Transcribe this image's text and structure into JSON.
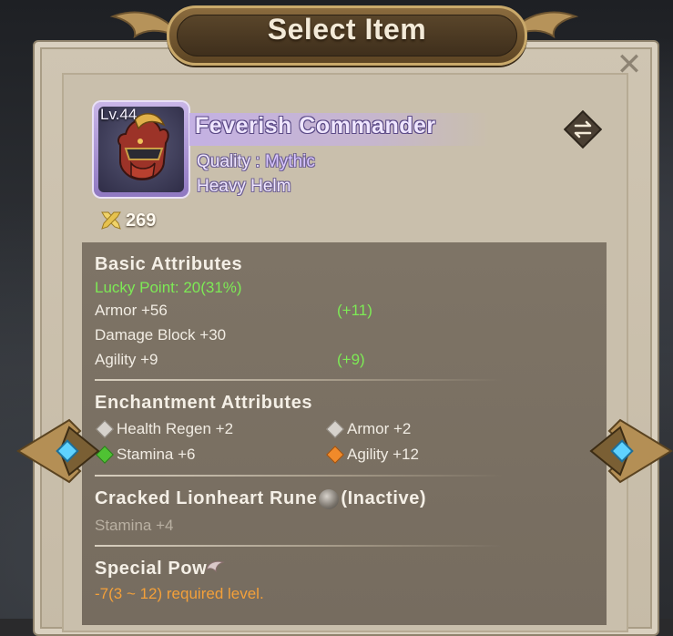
{
  "dialog": {
    "title": "Select Item",
    "close_icon": "close-icon"
  },
  "item": {
    "level": "Lv.44",
    "name": "Feverish Commander",
    "quality_label": "Quality : ",
    "quality_value": "Mythic",
    "type": "Heavy Helm",
    "power": "269",
    "icon": "helmet-icon",
    "swap_icon": "swap-arrows-icon",
    "quality_color": "#9b82d4"
  },
  "basic": {
    "title": "Basic Attributes",
    "lucky_point": "Lucky Point:  20(31%)",
    "rows": [
      {
        "label": "Armor +56",
        "bonus": "(+11)"
      },
      {
        "label": "Damage Block +30",
        "bonus": ""
      },
      {
        "label": "Agility +9",
        "bonus": "(+9)"
      }
    ]
  },
  "enchant": {
    "title": "Enchantment Attributes",
    "items": [
      {
        "label": "Health Regen +2",
        "gem": "gray-gem-icon",
        "color": "#d6d2cc"
      },
      {
        "label": "Armor +2",
        "gem": "gray-gem-icon",
        "color": "#d6d2cc"
      },
      {
        "label": "Stamina +6",
        "gem": "green-gem-icon",
        "color": "#4fc233"
      },
      {
        "label": "Agility +12",
        "gem": "orange-gem-icon",
        "color": "#f08a2a"
      }
    ]
  },
  "rune": {
    "title_name": "Cracked Lionheart Rune",
    "title_status": "(Inactive)",
    "stat": "Stamina +4"
  },
  "special": {
    "title": "Special Pow",
    "requirement": "-7(3 ~ 12) required level."
  },
  "colors": {
    "accent_green": "#7dea55",
    "accent_orange": "#f3a03a",
    "panel": "#c6bba7",
    "content": "#7a7062"
  }
}
